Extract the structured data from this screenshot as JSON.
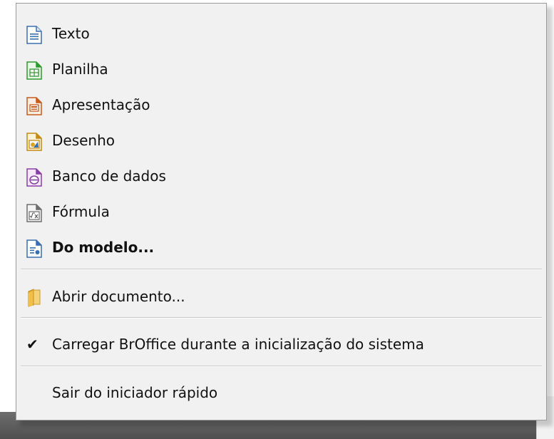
{
  "menu": {
    "items": [
      {
        "label": "Texto",
        "icon": "writer-document-icon",
        "color": "#2f6db3"
      },
      {
        "label": "Planilha",
        "icon": "calc-spreadsheet-icon",
        "color": "#2e9b2e"
      },
      {
        "label": "Apresentação",
        "icon": "impress-presentation-icon",
        "color": "#c85a1c"
      },
      {
        "label": "Desenho",
        "icon": "draw-drawing-icon",
        "color": "#e0a21e"
      },
      {
        "label": "Banco de dados",
        "icon": "base-database-icon",
        "color": "#8a3fa6"
      },
      {
        "label": "Fórmula",
        "icon": "math-formula-icon",
        "color": "#7a7a7a"
      },
      {
        "label": "Do modelo...",
        "icon": "template-icon",
        "color": "#2f6db3"
      }
    ],
    "open_document": {
      "label": "Abrir documento...",
      "icon": "folder-icon"
    },
    "startup": {
      "label": "Carregar BrOffice durante a inicialização do sistema",
      "checked": true,
      "check_glyph": "✔"
    },
    "exit": {
      "label": "Sair do iniciador rápido"
    }
  }
}
